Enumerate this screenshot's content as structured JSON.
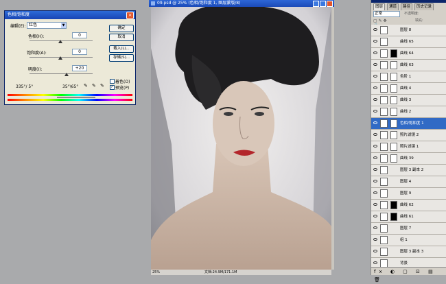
{
  "dialog": {
    "title": "色相/饱和度",
    "edit_label": "编辑(E):",
    "edit_value": "红色",
    "hue_label": "色相(H):",
    "hue_value": "0",
    "saturation_label": "饱和度(A):",
    "saturation_value": "0",
    "lightness_label": "明度(I):",
    "lightness_value": "+20",
    "range_left": "335°/ 5°",
    "range_right": "35°\\65°",
    "buttons": {
      "ok": "确定",
      "cancel": "取消",
      "load": "载入(L)...",
      "save": "存储(S)..."
    },
    "colorize_label": "着色(O)",
    "preview_label": "预览(P)",
    "preview_checked": true,
    "colorize_checked": false
  },
  "image_window": {
    "title": "09.psd @ 25% (色相/饱和度 1, 图层蒙版/8)",
    "zoom": "25%",
    "doc_size": "文档:24.9M/171.1M"
  },
  "layers_panel": {
    "tabs": [
      "图层",
      "通道",
      "路径",
      "历史记录"
    ],
    "blend_mode": "正常",
    "opacity_label": "不透明度:",
    "fill_label": "填充:",
    "layers": [
      {
        "name": "图层 8",
        "selected": false,
        "mask": false,
        "dark_thumb": false
      },
      {
        "name": "曲线 65",
        "selected": false,
        "mask": false,
        "dark_thumb": false
      },
      {
        "name": "曲线 64",
        "selected": false,
        "mask": true,
        "dark_thumb": true
      },
      {
        "name": "曲线 63",
        "selected": false,
        "mask": true,
        "dark_thumb": false
      },
      {
        "name": "色阶 1",
        "selected": false,
        "mask": true,
        "dark_thumb": false
      },
      {
        "name": "曲线 4",
        "selected": false,
        "mask": true,
        "dark_thumb": false
      },
      {
        "name": "曲线 3",
        "selected": false,
        "mask": true,
        "dark_thumb": false
      },
      {
        "name": "曲线 2",
        "selected": false,
        "mask": true,
        "dark_thumb": false
      },
      {
        "name": "色相/饱和度 1",
        "selected": true,
        "mask": true,
        "dark_thumb": false
      },
      {
        "name": "照片滤镜 2",
        "selected": false,
        "mask": true,
        "dark_thumb": false
      },
      {
        "name": "照片滤镜 1",
        "selected": false,
        "mask": true,
        "dark_thumb": false
      },
      {
        "name": "曲线 39",
        "selected": false,
        "mask": true,
        "dark_thumb": false
      },
      {
        "name": "图层 3 副本 2",
        "selected": false,
        "mask": false,
        "dark_thumb": false
      },
      {
        "name": "图层 4",
        "selected": false,
        "mask": false,
        "dark_thumb": false
      },
      {
        "name": "图层 9",
        "selected": false,
        "mask": false,
        "dark_thumb": false
      },
      {
        "name": "曲线 62",
        "selected": false,
        "mask": true,
        "dark_thumb": true
      },
      {
        "name": "曲线 61",
        "selected": false,
        "mask": true,
        "dark_thumb": true
      },
      {
        "name": "图层 7",
        "selected": false,
        "mask": false,
        "dark_thumb": false
      },
      {
        "name": "组 1",
        "selected": false,
        "mask": false,
        "dark_thumb": false
      },
      {
        "name": "图层 3 副本 3",
        "selected": false,
        "mask": false,
        "dark_thumb": false
      },
      {
        "name": "背景",
        "selected": false,
        "mask": false,
        "dark_thumb": false
      }
    ],
    "bottom_icons": "fx ◐ ▢ ⊡ ▤ 🗑"
  }
}
